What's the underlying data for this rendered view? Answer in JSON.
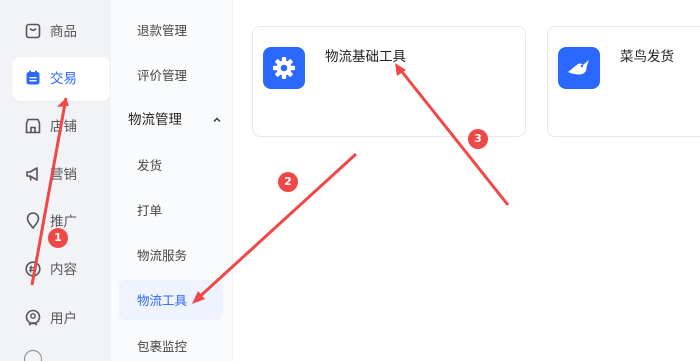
{
  "primary_nav": {
    "items": [
      {
        "label": "商品",
        "icon": "bag-icon"
      },
      {
        "label": "交易",
        "icon": "order-icon",
        "active": true
      },
      {
        "label": "店铺",
        "icon": "store-icon"
      },
      {
        "label": "营销",
        "icon": "megaphone-icon"
      },
      {
        "label": "推广",
        "icon": "location-pin-icon"
      },
      {
        "label": "内容",
        "icon": "hashtag-icon"
      },
      {
        "label": "用户",
        "icon": "user-icon"
      }
    ]
  },
  "secondary_nav": {
    "items_top": [
      "退款管理",
      "评价管理"
    ],
    "group": {
      "label": "物流管理",
      "expanded": true
    },
    "group_items": [
      "发货",
      "打单",
      "物流服务",
      "物流工具",
      "包裹监控"
    ],
    "active_item": "物流工具"
  },
  "tools": {
    "cards": [
      {
        "title": "物流基础工具",
        "icon": "gear-icon"
      },
      {
        "title": "菜鸟发货",
        "icon": "cainiao-bird-icon"
      }
    ]
  },
  "annotations": {
    "steps": [
      "1",
      "2",
      "3"
    ],
    "color": "#f04747"
  },
  "colors": {
    "accent": "#2a68ff",
    "annotation": "#f04747"
  }
}
